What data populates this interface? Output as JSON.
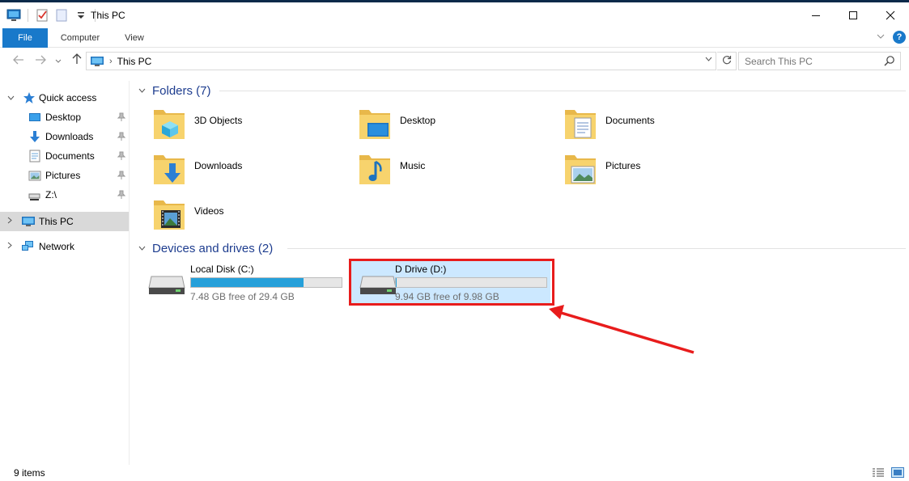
{
  "window": {
    "title": "This PC",
    "minimize_icon": "minimize-icon",
    "maximize_icon": "maximize-icon",
    "close_icon": "close-icon"
  },
  "quick_access_toolbar": {
    "icons": [
      "computer-icon",
      "properties-icon",
      "new-folder-icon",
      "customize-dropdown-icon"
    ]
  },
  "ribbon": {
    "tabs": [
      {
        "label": "File",
        "active": true
      },
      {
        "label": "Computer"
      },
      {
        "label": "View"
      }
    ],
    "help_label": "?",
    "accent": "#1979ca"
  },
  "address": {
    "path": "This PC",
    "separator": "›"
  },
  "search": {
    "placeholder": "Search This PC"
  },
  "nav_pane": {
    "quick_access": {
      "label": "Quick access",
      "items": [
        {
          "label": "Desktop",
          "pinned": true
        },
        {
          "label": "Downloads",
          "pinned": true
        },
        {
          "label": "Documents",
          "pinned": true
        },
        {
          "label": "Pictures",
          "pinned": true
        },
        {
          "label": "Z:\\",
          "pinned": true
        }
      ]
    },
    "this_pc": {
      "label": "This PC",
      "selected": true
    },
    "network": {
      "label": "Network"
    }
  },
  "folders_group": {
    "title": "Folders (7)",
    "folders": [
      {
        "label": "3D Objects",
        "icon": "3d-objects-folder-icon"
      },
      {
        "label": "Desktop",
        "icon": "desktop-folder-icon"
      },
      {
        "label": "Documents",
        "icon": "documents-folder-icon"
      },
      {
        "label": "Downloads",
        "icon": "downloads-folder-icon"
      },
      {
        "label": "Music",
        "icon": "music-folder-icon"
      },
      {
        "label": "Pictures",
        "icon": "pictures-folder-icon"
      },
      {
        "label": "Videos",
        "icon": "videos-folder-icon"
      }
    ]
  },
  "drives_group": {
    "title": "Devices and drives (2)",
    "drives": [
      {
        "label": "Local Disk (C:)",
        "free_text": "7.48 GB free of 29.4 GB",
        "used_fraction": 0.746
      },
      {
        "label": "D Drive (D:)",
        "free_text": "9.94 GB free of 9.98 GB",
        "used_fraction": 0.004,
        "selected": true
      }
    ]
  },
  "annotation": {
    "color": "#e81c1c"
  },
  "status_bar": {
    "item_count": "9 items"
  }
}
